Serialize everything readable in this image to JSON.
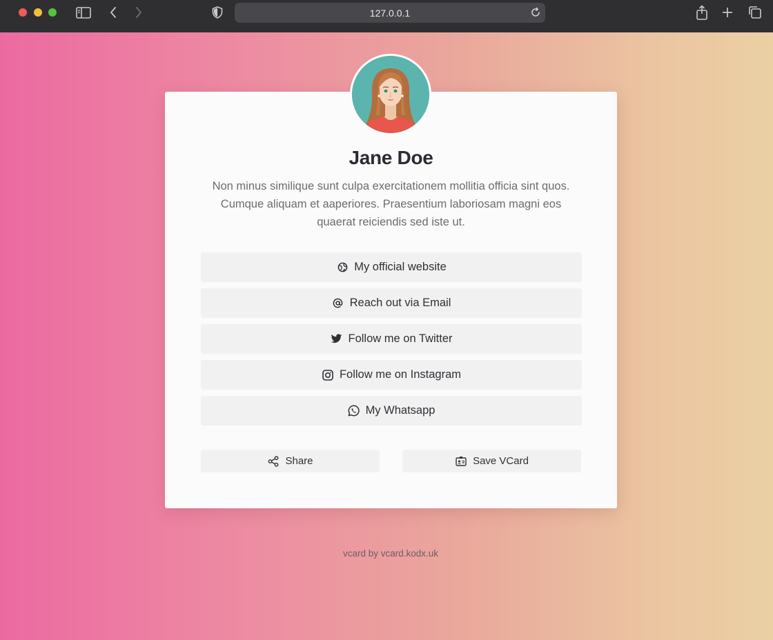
{
  "browser": {
    "address": "127.0.0.1"
  },
  "profile": {
    "name": "Jane Doe",
    "bio": "Non minus similique sunt culpa exercitationem mollitia officia sint quos. Cumque aliquam et aaperiores. Praesentium laboriosam magni eos quaerat reiciendis sed iste ut."
  },
  "links": [
    {
      "label": "My official website",
      "icon": "globe-icon"
    },
    {
      "label": "Reach out via Email",
      "icon": "at-sign-icon"
    },
    {
      "label": "Follow me on Twitter",
      "icon": "twitter-icon"
    },
    {
      "label": "Follow me on Instagram",
      "icon": "instagram-icon"
    },
    {
      "label": "My Whatsapp",
      "icon": "whatsapp-icon"
    }
  ],
  "actions": {
    "share_label": "Share",
    "save_label": "Save VCard"
  },
  "footer": {
    "text": "vcard by vcard.kodx.uk"
  },
  "colors": {
    "gradient_left": "#ec6aa1",
    "gradient_right": "#ebd0a4",
    "card": "#fbfbfb",
    "button": "#f1f1f1",
    "text_dark": "#2a2c33"
  }
}
